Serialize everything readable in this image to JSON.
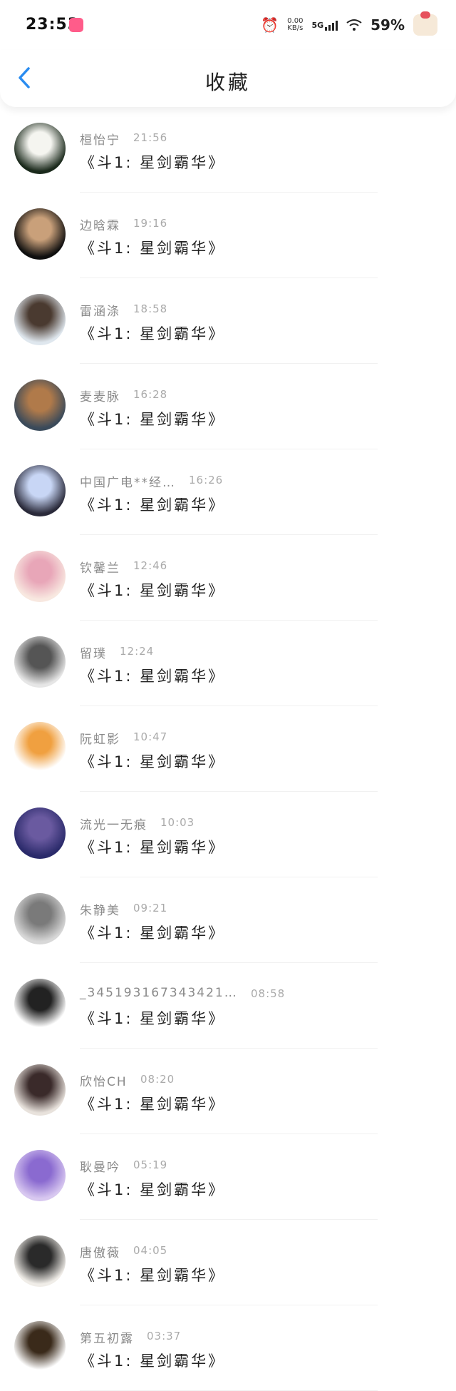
{
  "status_bar": {
    "time": "23:53",
    "net_speed_value": "0.00",
    "net_speed_unit": "KB/s",
    "network": "5G",
    "battery": "59%"
  },
  "header": {
    "title": "收藏"
  },
  "items": [
    {
      "name": "桓怡宁",
      "time": "21:56",
      "content": "《斗1: 星剑霸华》",
      "avatar_colors": [
        "#1b2a1c",
        "#f5f5f0"
      ]
    },
    {
      "name": "边晗霖",
      "time": "19:16",
      "content": "《斗1: 星剑霸华》",
      "avatar_colors": [
        "#0f0f0f",
        "#c9a07a"
      ]
    },
    {
      "name": "雷涵涤",
      "time": "18:58",
      "content": "《斗1: 星剑霸华》",
      "avatar_colors": [
        "#dfe7ee",
        "#4a3a30"
      ]
    },
    {
      "name": "麦麦脉",
      "time": "16:28",
      "content": "《斗1: 星剑霸华》",
      "avatar_colors": [
        "#3a4a5a",
        "#b07a4a"
      ]
    },
    {
      "name": "中国广电**经…",
      "time": "16:26",
      "content": "《斗1: 星剑霸华》",
      "avatar_colors": [
        "#2a2a3a",
        "#c8d6f5"
      ]
    },
    {
      "name": "钦馨兰",
      "time": "12:46",
      "content": "《斗1: 星剑霸华》",
      "avatar_colors": [
        "#f8e8e0",
        "#e8a6b8"
      ]
    },
    {
      "name": "留璞",
      "time": "12:24",
      "content": "《斗1: 星剑霸华》",
      "avatar_colors": [
        "#e6e6e6",
        "#555555"
      ]
    },
    {
      "name": "阮虹影",
      "time": "10:47",
      "content": "《斗1: 星剑霸华》",
      "avatar_colors": [
        "#ffffff",
        "#f0a040"
      ]
    },
    {
      "name": "流光一无痕",
      "time": "10:03",
      "content": "《斗1: 星剑霸华》",
      "avatar_colors": [
        "#2a2a6a",
        "#6a5aa0"
      ]
    },
    {
      "name": "朱静美",
      "time": "09:21",
      "content": "《斗1: 星剑霸华》",
      "avatar_colors": [
        "#d8d8d8",
        "#7a7a7a"
      ]
    },
    {
      "name": "_345193167343421…",
      "time": "08:58",
      "content": "《斗1: 星剑霸华》",
      "avatar_colors": [
        "#ffffff",
        "#222222"
      ]
    },
    {
      "name": "欣怡CH",
      "time": "08:20",
      "content": "《斗1: 星剑霸华》",
      "avatar_colors": [
        "#e8e2dc",
        "#3a2a2a"
      ]
    },
    {
      "name": "耿曼吟",
      "time": "05:19",
      "content": "《斗1: 星剑霸华》",
      "avatar_colors": [
        "#d8c8f0",
        "#8a6ad0"
      ]
    },
    {
      "name": "唐傲薇",
      "time": "04:05",
      "content": "《斗1: 星剑霸华》",
      "avatar_colors": [
        "#f0ede8",
        "#2a2a2a"
      ]
    },
    {
      "name": "第五初露",
      "time": "03:37",
      "content": "《斗1: 星剑霸华》",
      "avatar_colors": [
        "#ffffff",
        "#3a2a1a"
      ]
    }
  ]
}
